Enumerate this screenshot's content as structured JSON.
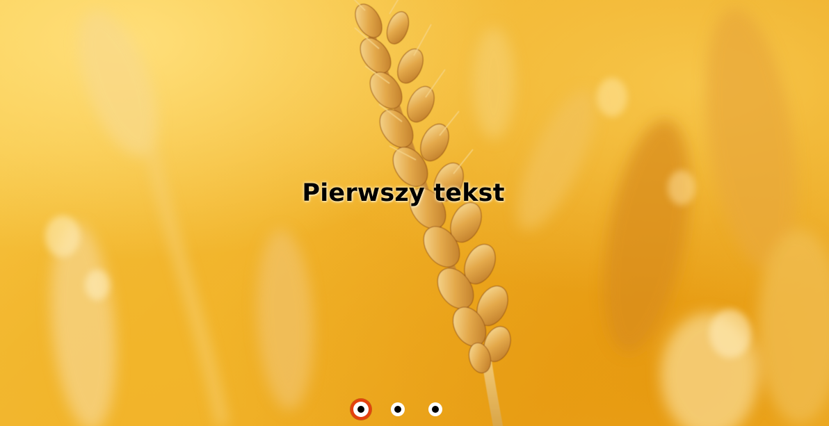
{
  "slide": {
    "caption": "Pierwszy tekst",
    "background": "wheat-field-photo"
  },
  "pagination": {
    "count": 3,
    "active_index": 0,
    "active_ring_color": "#e4410e",
    "dot_color": "#ffffff",
    "dot_center_color": "#000000"
  }
}
